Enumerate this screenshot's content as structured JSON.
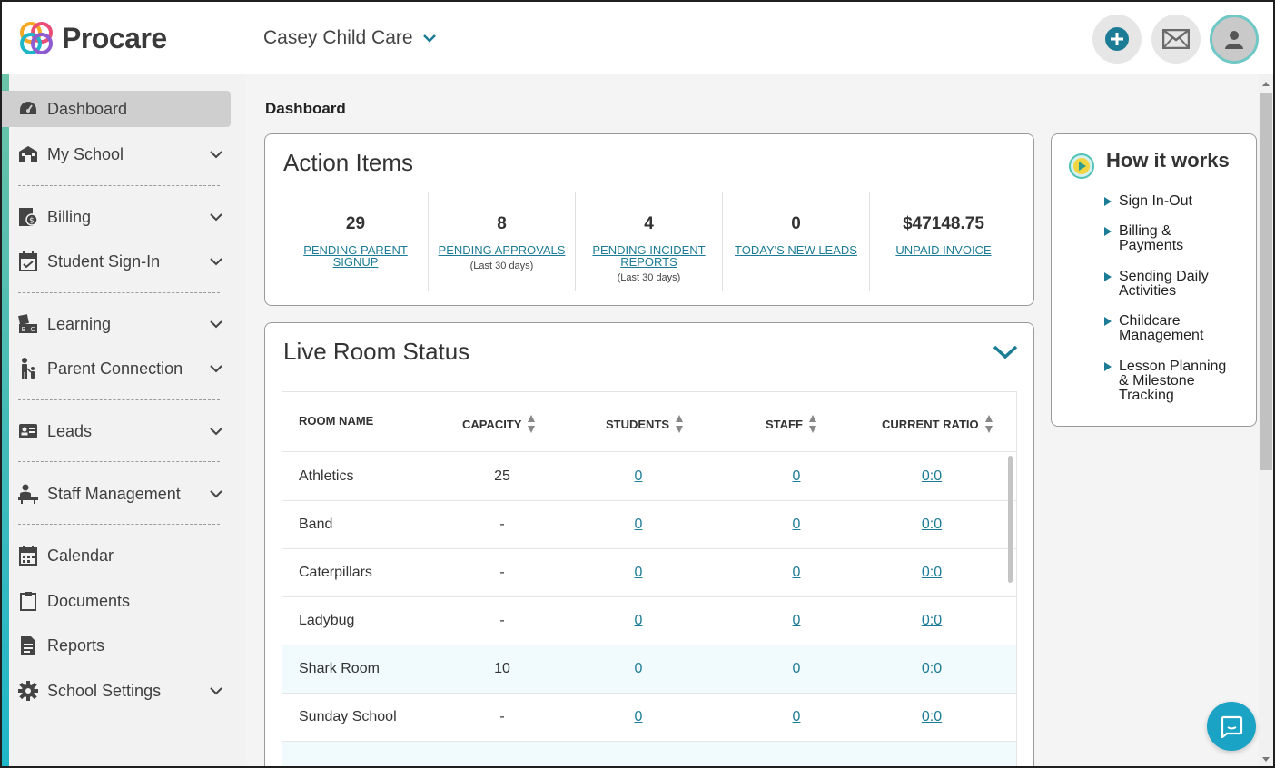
{
  "brand": {
    "name": "Procare"
  },
  "header": {
    "school_name": "Casey Child Care",
    "icons": [
      "add-icon",
      "mail-icon",
      "user-avatar-icon"
    ]
  },
  "sidebar": {
    "items": [
      {
        "label": "Dashboard",
        "icon": "dashboard-icon",
        "active": true,
        "has_chevron": false
      },
      {
        "label": "My School",
        "icon": "school-icon",
        "has_chevron": true
      },
      {
        "label": "Billing",
        "icon": "billing-icon",
        "has_chevron": true
      },
      {
        "label": "Student Sign-In",
        "icon": "calendar-check-icon",
        "has_chevron": true
      },
      {
        "label": "Learning",
        "icon": "blocks-icon",
        "has_chevron": true
      },
      {
        "label": "Parent Connection",
        "icon": "parent-child-icon",
        "has_chevron": true
      },
      {
        "label": "Leads",
        "icon": "id-card-icon",
        "has_chevron": true
      },
      {
        "label": "Staff Management",
        "icon": "teacher-icon",
        "has_chevron": true
      },
      {
        "label": "Calendar",
        "icon": "calendar-icon",
        "has_chevron": false
      },
      {
        "label": "Documents",
        "icon": "clipboard-icon",
        "has_chevron": false
      },
      {
        "label": "Reports",
        "icon": "report-icon",
        "has_chevron": false
      },
      {
        "label": "School Settings",
        "icon": "gear-icon",
        "has_chevron": true
      }
    ]
  },
  "main": {
    "page_title": "Dashboard",
    "action_items": {
      "title": "Action Items",
      "items": [
        {
          "value": "29",
          "label_line1": "PENDING PARENT",
          "label_line2": "SIGNUP",
          "sub": ""
        },
        {
          "value": "8",
          "label_line1": "PENDING APPROVALS",
          "label_line2": "",
          "sub": "(Last 30 days)"
        },
        {
          "value": "4",
          "label_line1": "PENDING INCIDENT",
          "label_line2": "REPORTS",
          "sub": "(Last 30 days)"
        },
        {
          "value": "0",
          "label_line1": "TODAY'S NEW LEADS",
          "label_line2": "",
          "sub": ""
        },
        {
          "value": "$47148.75",
          "label_line1": "UNPAID INVOICE",
          "label_line2": "",
          "sub": ""
        }
      ]
    },
    "live_room_status": {
      "title": "Live Room Status",
      "columns": [
        "ROOM NAME",
        "CAPACITY",
        "STUDENTS",
        "STAFF",
        "CURRENT RATIO"
      ],
      "rows": [
        {
          "room": "Athletics",
          "capacity": "25",
          "students": "0",
          "staff": "0",
          "ratio": "0:0"
        },
        {
          "room": "Band",
          "capacity": "-",
          "students": "0",
          "staff": "0",
          "ratio": "0:0"
        },
        {
          "room": "Caterpillars",
          "capacity": "-",
          "students": "0",
          "staff": "0",
          "ratio": "0:0"
        },
        {
          "room": "Ladybug",
          "capacity": "-",
          "students": "0",
          "staff": "0",
          "ratio": "0:0"
        },
        {
          "room": "Shark Room",
          "capacity": "10",
          "students": "0",
          "staff": "0",
          "ratio": "0:0"
        },
        {
          "room": "Sunday School",
          "capacity": "-",
          "students": "0",
          "staff": "0",
          "ratio": "0:0"
        }
      ]
    },
    "how_it_works": {
      "title": "How it works",
      "items": [
        {
          "line1": "Sign In-Out",
          "line2": "",
          "line3": ""
        },
        {
          "line1": "Billing &",
          "line2": "Payments",
          "line3": ""
        },
        {
          "line1": "Sending Daily",
          "line2": "Activities",
          "line3": ""
        },
        {
          "line1": "Childcare",
          "line2": "Management",
          "line3": ""
        },
        {
          "line1": "Lesson Planning",
          "line2": "& Milestone",
          "line3": "Tracking"
        }
      ]
    }
  },
  "colors": {
    "link": "#1c7c95",
    "accent": "#1fb6c9",
    "sidebar_bg": "#f2f2f2",
    "active_item": "#cfcfcf",
    "chat_button": "#1aa3c4"
  }
}
